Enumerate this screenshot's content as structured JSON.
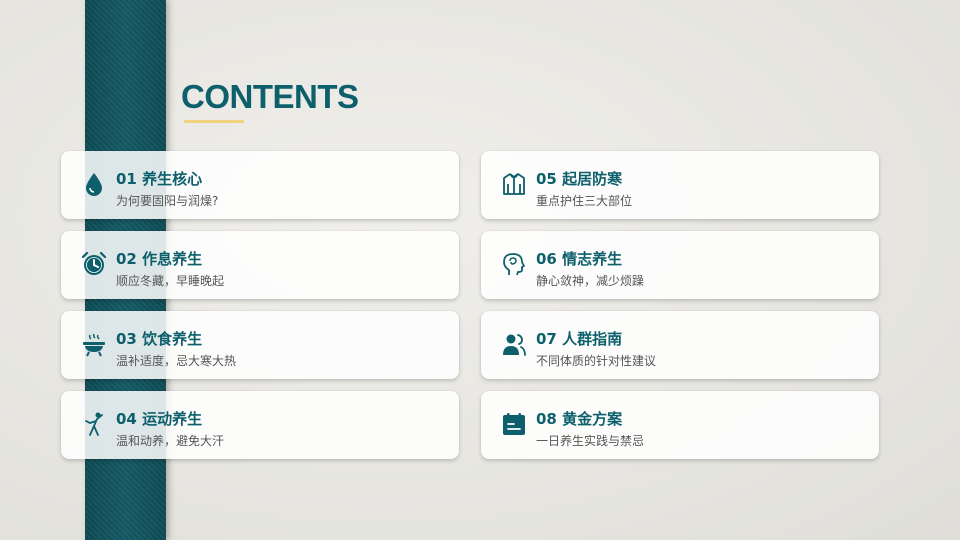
{
  "title": "CONTENTS",
  "accent_color": "#0d5f6b",
  "underline_color": "#f0d27a",
  "items": [
    {
      "heading": "01 养生核心",
      "sub": "为何要固阳与润燥?",
      "icon": "drop-icon"
    },
    {
      "heading": "02 作息养生",
      "sub": "顺应冬藏，早睡晚起",
      "icon": "alarm-clock-icon"
    },
    {
      "heading": "03 饮食养生",
      "sub": "温补适度，忌大寒大热",
      "icon": "hotpot-icon"
    },
    {
      "heading": "04 运动养生",
      "sub": "温和动养，避免大汗",
      "icon": "exercise-icon"
    },
    {
      "heading": "05 起居防寒",
      "sub": "重点护住三大部位",
      "icon": "jacket-icon"
    },
    {
      "heading": "06 情志养生",
      "sub": "静心敛神，减少烦躁",
      "icon": "head-mind-icon"
    },
    {
      "heading": "07 人群指南",
      "sub": "不同体质的针对性建议",
      "icon": "people-icon"
    },
    {
      "heading": "08 黄金方案",
      "sub": "一日养生实践与禁忌",
      "icon": "calendar-icon"
    }
  ]
}
